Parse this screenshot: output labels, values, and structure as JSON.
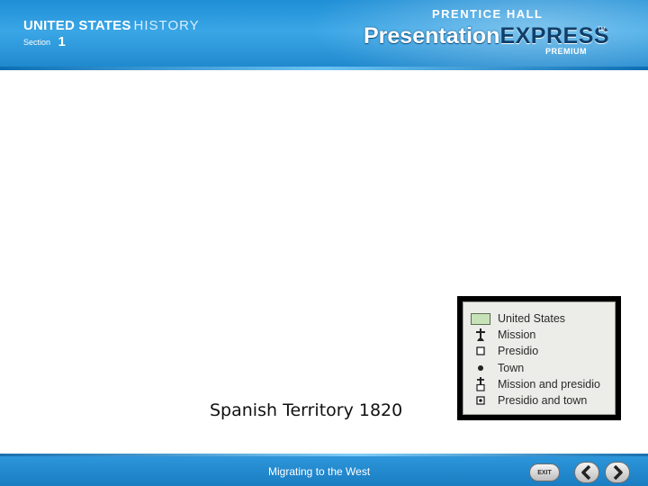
{
  "header": {
    "brand_primary": "UNITED STATES",
    "brand_secondary": "HISTORY",
    "section_label": "Section",
    "section_number": "1",
    "publisher": "PRENTICE HALL",
    "product_main": "Presentation",
    "product_express": "EXPRESS",
    "trademark": "TM",
    "product_tier": "PREMIUM"
  },
  "legend": {
    "items": [
      {
        "label": "United States",
        "symbol": "green-swatch"
      },
      {
        "label": "Mission",
        "symbol": "mission-cross"
      },
      {
        "label": "Presidio",
        "symbol": "presidio-square"
      },
      {
        "label": "Town",
        "symbol": "town-dot"
      },
      {
        "label": "Mission and presidio",
        "symbol": "mission-presidio"
      },
      {
        "label": "Presidio and town",
        "symbol": "presidio-town"
      }
    ]
  },
  "caption": "Spanish Territory 1820",
  "footer": {
    "title": "Migrating to the West",
    "exit_label": "EXIT",
    "prev_icon": "chevron-left-icon",
    "next_icon": "chevron-right-icon"
  },
  "colors": {
    "header_blue": "#1f8fd6",
    "footer_blue": "#1a7dc2",
    "us_swatch": "#c8e2b8"
  }
}
